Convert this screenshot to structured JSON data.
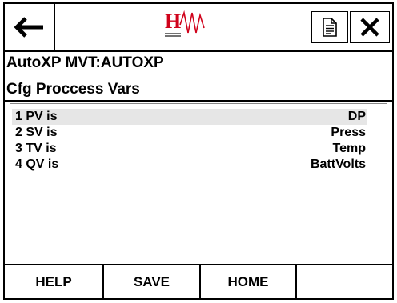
{
  "header": {
    "device_title": "AutoXP MVT:AUTOXP",
    "screen_title": "Cfg Proccess Vars",
    "logo_letter": "H"
  },
  "icons": {
    "back": "left-arrow-icon",
    "doc": "document-icon",
    "close": "close-icon"
  },
  "colors": {
    "logo_red": "#d0021b",
    "selected_row": "#e6e6e6"
  },
  "variables": [
    {
      "label": "1 PV is",
      "value": "DP"
    },
    {
      "label": "2 SV is",
      "value": "Press"
    },
    {
      "label": "3 TV is",
      "value": "Temp"
    },
    {
      "label": "4 QV is",
      "value": "BattVolts"
    }
  ],
  "footer": {
    "help": "HELP",
    "save": "SAVE",
    "home": "HOME"
  }
}
